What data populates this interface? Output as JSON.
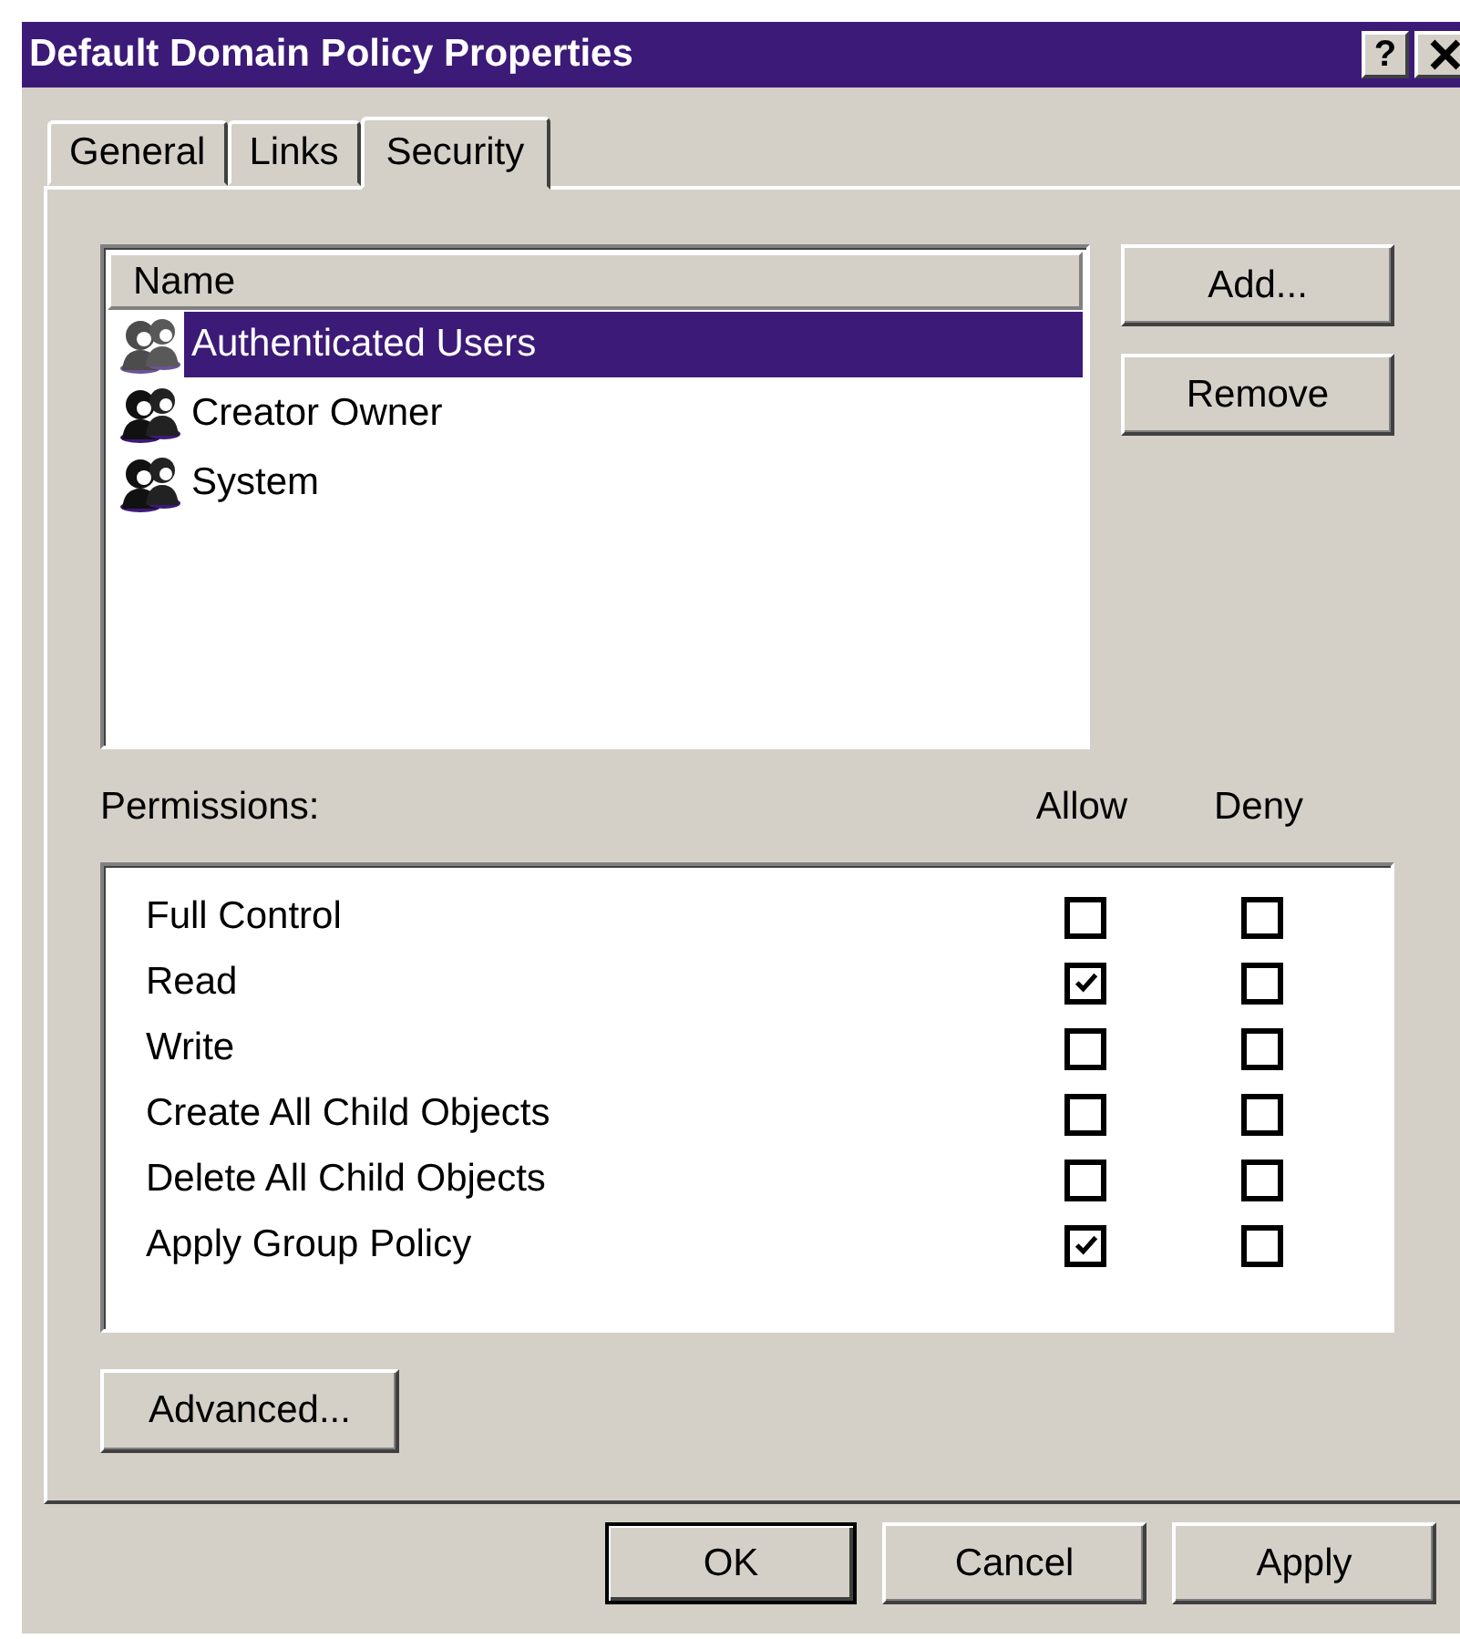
{
  "window": {
    "title": "Default Domain Policy Properties",
    "help_button": "?"
  },
  "tabs": [
    {
      "label": "General",
      "selected": false
    },
    {
      "label": "Links",
      "selected": false
    },
    {
      "label": "Security",
      "selected": true
    }
  ],
  "names_list": {
    "column": "Name",
    "items": [
      {
        "name": "Authenticated Users",
        "selected": true
      },
      {
        "name": "Creator Owner",
        "selected": false
      },
      {
        "name": "System",
        "selected": false
      }
    ]
  },
  "list_buttons": [
    "Add...",
    "Remove"
  ],
  "permissions": {
    "label": "Permissions:",
    "allow_header": "Allow",
    "deny_header": "Deny",
    "rows": [
      {
        "name": "Full Control",
        "allow": false,
        "deny": false
      },
      {
        "name": "Read",
        "allow": true,
        "deny": false
      },
      {
        "name": "Write",
        "allow": false,
        "deny": false
      },
      {
        "name": "Create All Child Objects",
        "allow": false,
        "deny": false
      },
      {
        "name": "Delete All Child Objects",
        "allow": false,
        "deny": false
      },
      {
        "name": "Apply Group Policy",
        "allow": true,
        "deny": false
      }
    ]
  },
  "advanced_button": "Advanced...",
  "buttons": [
    {
      "label": "OK",
      "default": true
    },
    {
      "label": "Cancel",
      "default": false
    },
    {
      "label": "Apply",
      "default": false
    }
  ]
}
